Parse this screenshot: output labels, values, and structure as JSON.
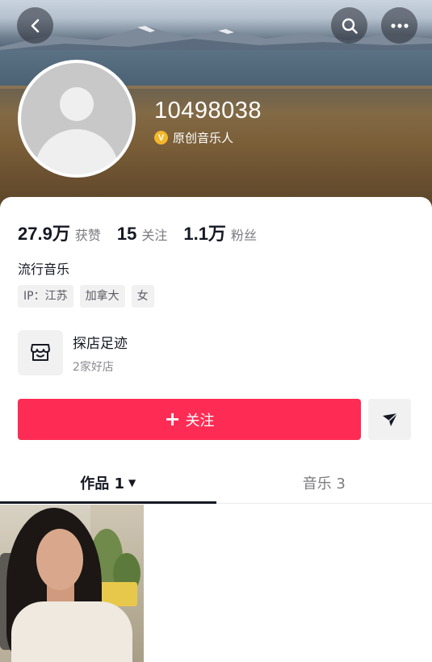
{
  "profile": {
    "username": "10498038",
    "verified_label": "原创音乐人",
    "verified_badge": "V"
  },
  "stats": [
    {
      "value": "27.9万",
      "label": "获赞"
    },
    {
      "value": "15",
      "label": "关注"
    },
    {
      "value": "1.1万",
      "label": "粉丝"
    }
  ],
  "bio": "流行音乐",
  "tags": [
    "IP：江苏",
    "加拿大",
    "女"
  ],
  "shop": {
    "title": "探店足迹",
    "subtitle": "2家好店"
  },
  "actions": {
    "follow_plus": "+",
    "follow_label": "关注"
  },
  "tabs": [
    {
      "label": "作品 1",
      "caret": "▼",
      "active": true
    },
    {
      "label": "音乐 3",
      "active": false
    }
  ],
  "colors": {
    "accent": "#fe2c55",
    "badge": "#f3b72b"
  },
  "icons": {
    "back": "back-arrow-icon",
    "search": "search-icon",
    "more": "more-icon",
    "shop": "shop-icon",
    "share": "share-icon"
  }
}
